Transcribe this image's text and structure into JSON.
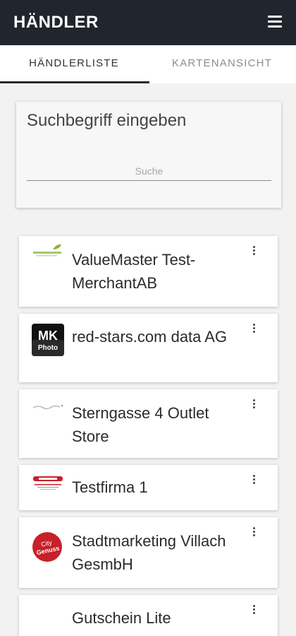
{
  "header": {
    "title": "HÄNDLER",
    "menu_icon": "hamburger-menu-icon"
  },
  "tabs": [
    {
      "label": "HÄNDLERLISTE",
      "active": true
    },
    {
      "label": "KARTENANSICHT",
      "active": false
    }
  ],
  "search": {
    "prompt": "Suchbegriff eingeben",
    "placeholder": "Suche",
    "value": ""
  },
  "merchants": [
    {
      "name": "ValueMaster Test-MerchantAB",
      "logo_icon": "valuemaster-logo-icon"
    },
    {
      "name": "red-stars.com data AG",
      "logo_icon": "mk-photo-logo-icon",
      "logo_text_top": "MK",
      "logo_text_bottom": "Photo"
    },
    {
      "name": "Sterngasse 4 Outlet Store",
      "logo_icon": "sterngasse-logo-icon"
    },
    {
      "name": "Testfirma 1",
      "logo_icon": "testfirma-logo-icon"
    },
    {
      "name": "Stadtmarketing Villach GesmbH",
      "logo_icon": "city-genuss-logo-icon",
      "logo_text_top": "City",
      "logo_text_bottom": "Genuss"
    },
    {
      "name": "Gutschein Lite",
      "logo_icon": "none"
    }
  ],
  "colors": {
    "header_bg": "#21252d",
    "logo_red": "#c8202a",
    "logo_green": "#8cb33c"
  }
}
